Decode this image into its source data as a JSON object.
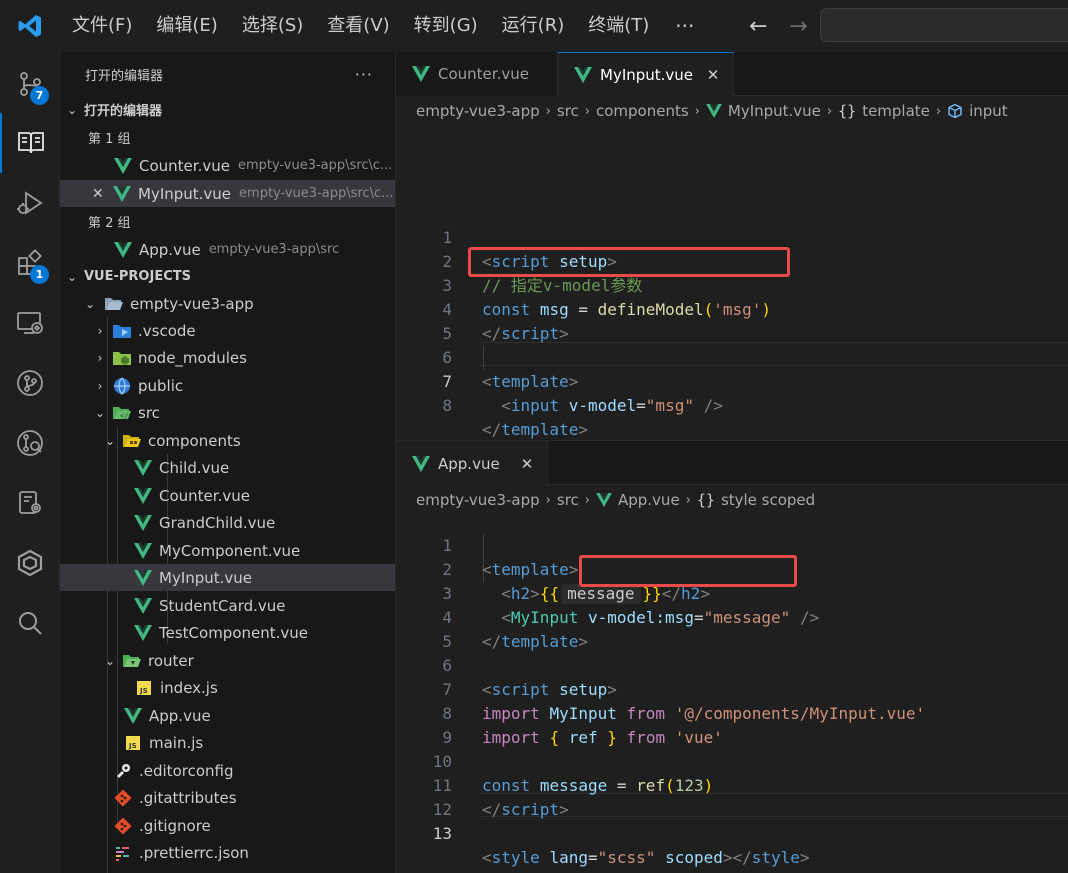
{
  "menu": [
    "文件(F)",
    "编辑(E)",
    "选择(S)",
    "查看(V)",
    "转到(G)",
    "运行(R)",
    "终端(T)"
  ],
  "menu_more": "···",
  "nav": {
    "back": "←",
    "forward": "→"
  },
  "activity": {
    "scm_badge": "7",
    "extensions_badge": "1"
  },
  "sidebar": {
    "header": "打开的编辑器",
    "more": "···",
    "open_editors_section": "打开的编辑器",
    "group1": "第 1 组",
    "group2": "第 2 组",
    "open_files": [
      {
        "name": "Counter.vue",
        "path": "empty-vue3-app\\src\\c..."
      },
      {
        "name": "MyInput.vue",
        "path": "empty-vue3-app\\src\\c..."
      },
      {
        "name": "App.vue",
        "path": "empty-vue3-app\\src"
      }
    ],
    "project_section": "VUE-PROJECTS",
    "tree": {
      "root": "empty-vue3-app",
      "vscode": ".vscode",
      "node_modules": "node_modules",
      "public": "public",
      "src": "src",
      "components": "components",
      "child": "Child.vue",
      "counter": "Counter.vue",
      "grandchild": "GrandChild.vue",
      "mycomponent": "MyComponent.vue",
      "myinput": "MyInput.vue",
      "studentcard": "StudentCard.vue",
      "testcomponent": "TestComponent.vue",
      "router": "router",
      "indexjs": "index.js",
      "appvue": "App.vue",
      "mainjs": "main.js",
      "editorconfig": ".editorconfig",
      "gitattributes": ".gitattributes",
      "gitignore": ".gitignore",
      "prettierrc": ".prettierrc.json"
    }
  },
  "editor_top": {
    "tabs": [
      {
        "label": "Counter.vue"
      },
      {
        "label": "MyInput.vue"
      }
    ],
    "close": "✕",
    "breadcrumb": [
      "empty-vue3-app",
      "src",
      "components",
      "MyInput.vue",
      "template",
      "input"
    ],
    "line_numbers": [
      "1",
      "2",
      "3",
      "4",
      "5",
      "6",
      "7",
      "8"
    ],
    "code": {
      "script_open_tag": "script",
      "setup": "setup",
      "comment": "// 指定v-model参数",
      "const": "const",
      "msg_var": "msg",
      "eq": "=",
      "define_model": "defineModel",
      "msg_arg": "'msg'",
      "script_close_tag": "script",
      "template_open_tag": "template",
      "input_tag": "input",
      "vmodel_attr": "v-model",
      "vmodel_value": "\"msg\"",
      "template_close_tag": "template"
    }
  },
  "editor_bottom": {
    "tab": "App.vue",
    "close": "✕",
    "breadcrumb": [
      "empty-vue3-app",
      "src",
      "App.vue",
      "style scoped"
    ],
    "line_numbers": [
      "1",
      "2",
      "3",
      "4",
      "5",
      "6",
      "7",
      "8",
      "9",
      "10",
      "11",
      "12",
      "13"
    ],
    "code": {
      "template_open_tag": "template",
      "h2": "h2",
      "message_inlay": "message",
      "myinput_tag": "MyInput",
      "vmodel_msg_attr": "v-model:msg",
      "vmodel_msg_value": "\"message\"",
      "template_close_tag": "template",
      "script_open_tag": "script",
      "setup": "setup",
      "import": "import",
      "myinput_ident": "MyInput",
      "from": "from",
      "path_myinput": "'@/components/MyInput.vue'",
      "ref": "ref",
      "vue_str": "'vue'",
      "const": "const",
      "message_var": "message",
      "number": "123",
      "script_close_tag": "script",
      "style_tag": "style",
      "lang_attr": "lang",
      "lang_value": "\"scss\"",
      "scoped": "scoped"
    }
  },
  "colors": {
    "accent": "#0078d4",
    "highlight": "#e94a4a",
    "vue_green": "#41b883"
  }
}
